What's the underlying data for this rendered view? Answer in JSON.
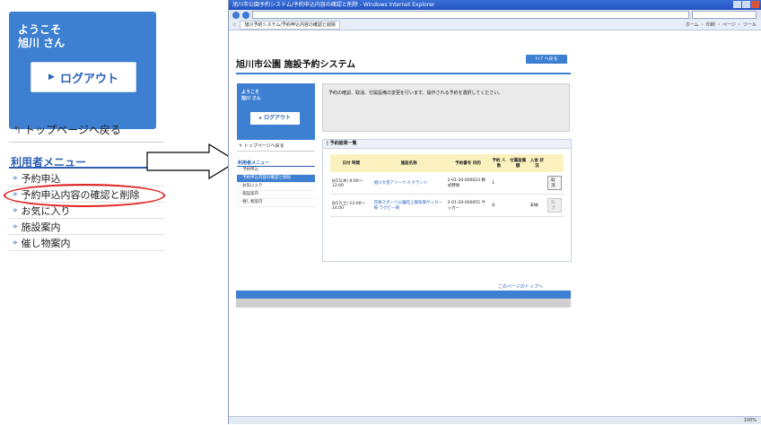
{
  "left_panel": {
    "welcome_line1": "ようこそ",
    "welcome_line2": "旭川 さん",
    "logout_label": "ログアウト",
    "back_to_top": "トップページへ戻る",
    "menu_title": "利用者メニュー",
    "menu_items": [
      {
        "label": "予約申込"
      },
      {
        "label": "予約申込内容の確認と削除"
      },
      {
        "label": "お気に入り"
      },
      {
        "label": "施設案内"
      },
      {
        "label": "催し物案内"
      }
    ]
  },
  "browser": {
    "window_title": "旭川市公園予約システム/予約申込内容の確認と削除 - Windows Internet Explorer",
    "tab_title": "旭川予約システム/予約申込内容の確認と削除",
    "toolbar_text": "ホーム ・ 印刷 ・ ページ ・ ツール",
    "status_text": "100%"
  },
  "site": {
    "title": "旭川市公園 施設予約システム",
    "top_button": "ﾄｯﾌﾟへ戻る",
    "welcome_line1": "ようこそ",
    "welcome_line2": "旭川 さん",
    "logout_label": "ログアウト",
    "notice": "予約の確認、取消、付属設備の変更を行います。操作される予約を選択してください。",
    "back_to_top": "トップページへ戻る",
    "menu_title": "利用者メニュー",
    "menu_items": [
      "予約申込",
      "予約申込内容の確認と削除",
      "お気に入り",
      "施設案内",
      "催し物案内"
    ],
    "result_title": "予約結果一覧",
    "table_headers": [
      "日付 時間",
      "施設名称",
      "予約番号 目的",
      "予約 人数",
      "付属設備 額",
      "入金 状況",
      ""
    ],
    "rows": [
      {
        "date": "8/15(木) 9:00～ 12:00",
        "facility": "旭川大雪アリーナ A グランド",
        "number": "2-01-20-000023 軟式野球",
        "people": "1",
        "equip": "",
        "payment": "",
        "action": "取消"
      },
      {
        "date": "8/17(土) 12:00～ 14:00",
        "facility": "花咲スポーツ公園陸上競技場サッカー場 ラグビー場",
        "number": "2-01-20-000055 サッカー",
        "people": "8",
        "equip": "",
        "payment": "未納",
        "action": "取消"
      }
    ],
    "page_top_link": "このページのトップへ"
  }
}
